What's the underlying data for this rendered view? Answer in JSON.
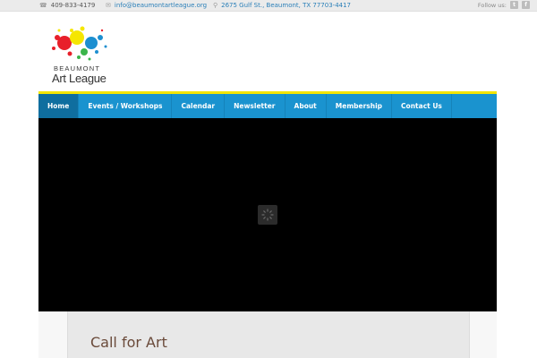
{
  "topbar": {
    "phone": "409-833-4179",
    "email": "info@beaumontartleague.org",
    "address": "2675 Gulf St., Beaumont, TX 77703-4417",
    "follow_label": "Follow us:",
    "social": [
      {
        "icon": "twitter-icon",
        "glyph": "t"
      },
      {
        "icon": "facebook-icon",
        "glyph": "f"
      }
    ]
  },
  "logo": {
    "line1": "BEAUMONT",
    "line2": "Art League"
  },
  "nav": {
    "items": [
      {
        "label": "Home",
        "active": true
      },
      {
        "label": "Events / Workshops",
        "active": false
      },
      {
        "label": "Calendar",
        "active": false
      },
      {
        "label": "Newsletter",
        "active": false
      },
      {
        "label": "About",
        "active": false
      },
      {
        "label": "Membership",
        "active": false
      },
      {
        "label": "Contact Us",
        "active": false
      }
    ]
  },
  "content": {
    "title": "Call for Art"
  },
  "colors": {
    "nav_bg": "#1a93cf",
    "nav_active": "#0f6e9f",
    "accent_line": "#f3e500",
    "title": "#6a4a3a"
  }
}
